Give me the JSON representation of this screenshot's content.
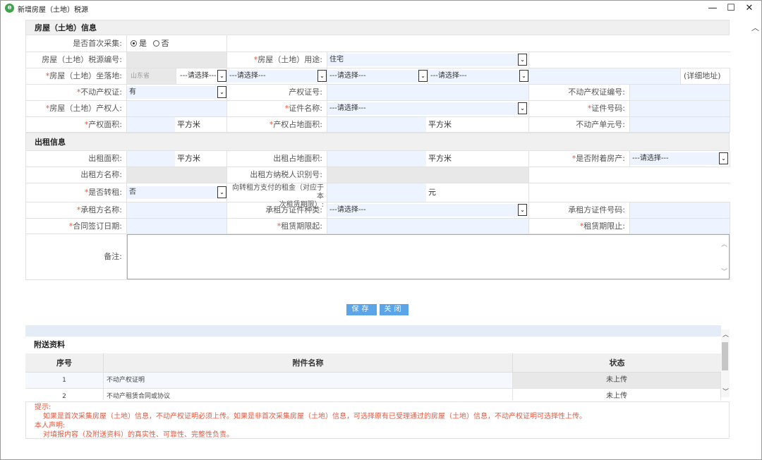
{
  "window": {
    "title": "新增房屋（土地）税源",
    "icon_glyph": "e",
    "buttons": {
      "min": "—",
      "max": "☐",
      "close": "✕"
    }
  },
  "house": {
    "section_title": "房屋（土地）信息",
    "first_collect_label": "是否首次采集:",
    "first_yes": "是",
    "first_no": "否",
    "source_no_label": "房屋（土地）税源编号:",
    "usage_label": "房屋（土地）用途:",
    "usage_value": "住宅",
    "location_label": "房屋（土地）坐落地:",
    "province_value": "山东省",
    "city_select": "---请选择---",
    "district_select": "---请选择---",
    "street_select": "---请选择---",
    "community_select": "---请选择---",
    "detail_hint": "(详细地址)",
    "cert_label": "不动产权证:",
    "cert_value": "有",
    "cert_no_label": "产权证号:",
    "cert_serial_label": "不动产权证编号:",
    "owner_label": "房屋（土地）产权人:",
    "id_type_label": "证件名称:",
    "id_type_value": "---请选择---",
    "id_no_label": "证件号码:",
    "area_label": "产权面积:",
    "area_unit": "平方米",
    "land_area_label": "产权占地面积:",
    "land_area_unit": "平方米",
    "unit_no_label": "不动产单元号:"
  },
  "lease": {
    "section_title": "出租信息",
    "rent_area_label": "出租面积:",
    "rent_area_unit": "平方米",
    "rent_land_label": "出租占地面积:",
    "rent_land_unit": "平方米",
    "attached_label": "是否附着房产:",
    "attached_value": "---请选择---",
    "lessor_name_label": "出租方名称:",
    "lessor_tax_label": "出租方纳税人识别号:",
    "sublease_label": "是否转租:",
    "sublease_value": "否",
    "rent_paid_label_1": "向转租方支付的租金（对应于本",
    "rent_paid_label_2": "次租赁期限）:",
    "rent_paid_unit": "元",
    "lessee_name_label": "承租方名称:",
    "lessee_id_type_label": "承租方证件种类:",
    "lessee_id_type_value": "---请选择---",
    "lessee_id_no_label": "承租方证件号码:",
    "contract_date_label": "合同签订日期:",
    "start_label": "租赁期限起:",
    "end_label": "租赁期限止:",
    "remark_label": "备注:"
  },
  "actions": {
    "save": "保存",
    "close": "关闭"
  },
  "attachments": {
    "title": "附送资料",
    "headers": {
      "no": "序号",
      "name": "附件名称",
      "status": "状态"
    },
    "rows": [
      {
        "no": "1",
        "name": "不动产权证明",
        "status": "未上传"
      },
      {
        "no": "2",
        "name": "不动产租赁合同或协议",
        "status": "未上传"
      }
    ]
  },
  "notice": {
    "tip_title": "提示:",
    "tip_text": "如果是首次采集房屋（土地）信息，不动产权证明必须上传。如果是非首次采集房屋（土地）信息，可选择原有已受理通过的房屋（土地）信息，不动产权证明可选择性上传。",
    "declare_title": "本人声明:",
    "declare_text": "对填报内容（及附送资料）的真实性、可靠性、完整性负责。"
  },
  "colors": {
    "accent": "#5ba4e8",
    "required": "#e8573d",
    "input_bg": "#edf4ff"
  }
}
